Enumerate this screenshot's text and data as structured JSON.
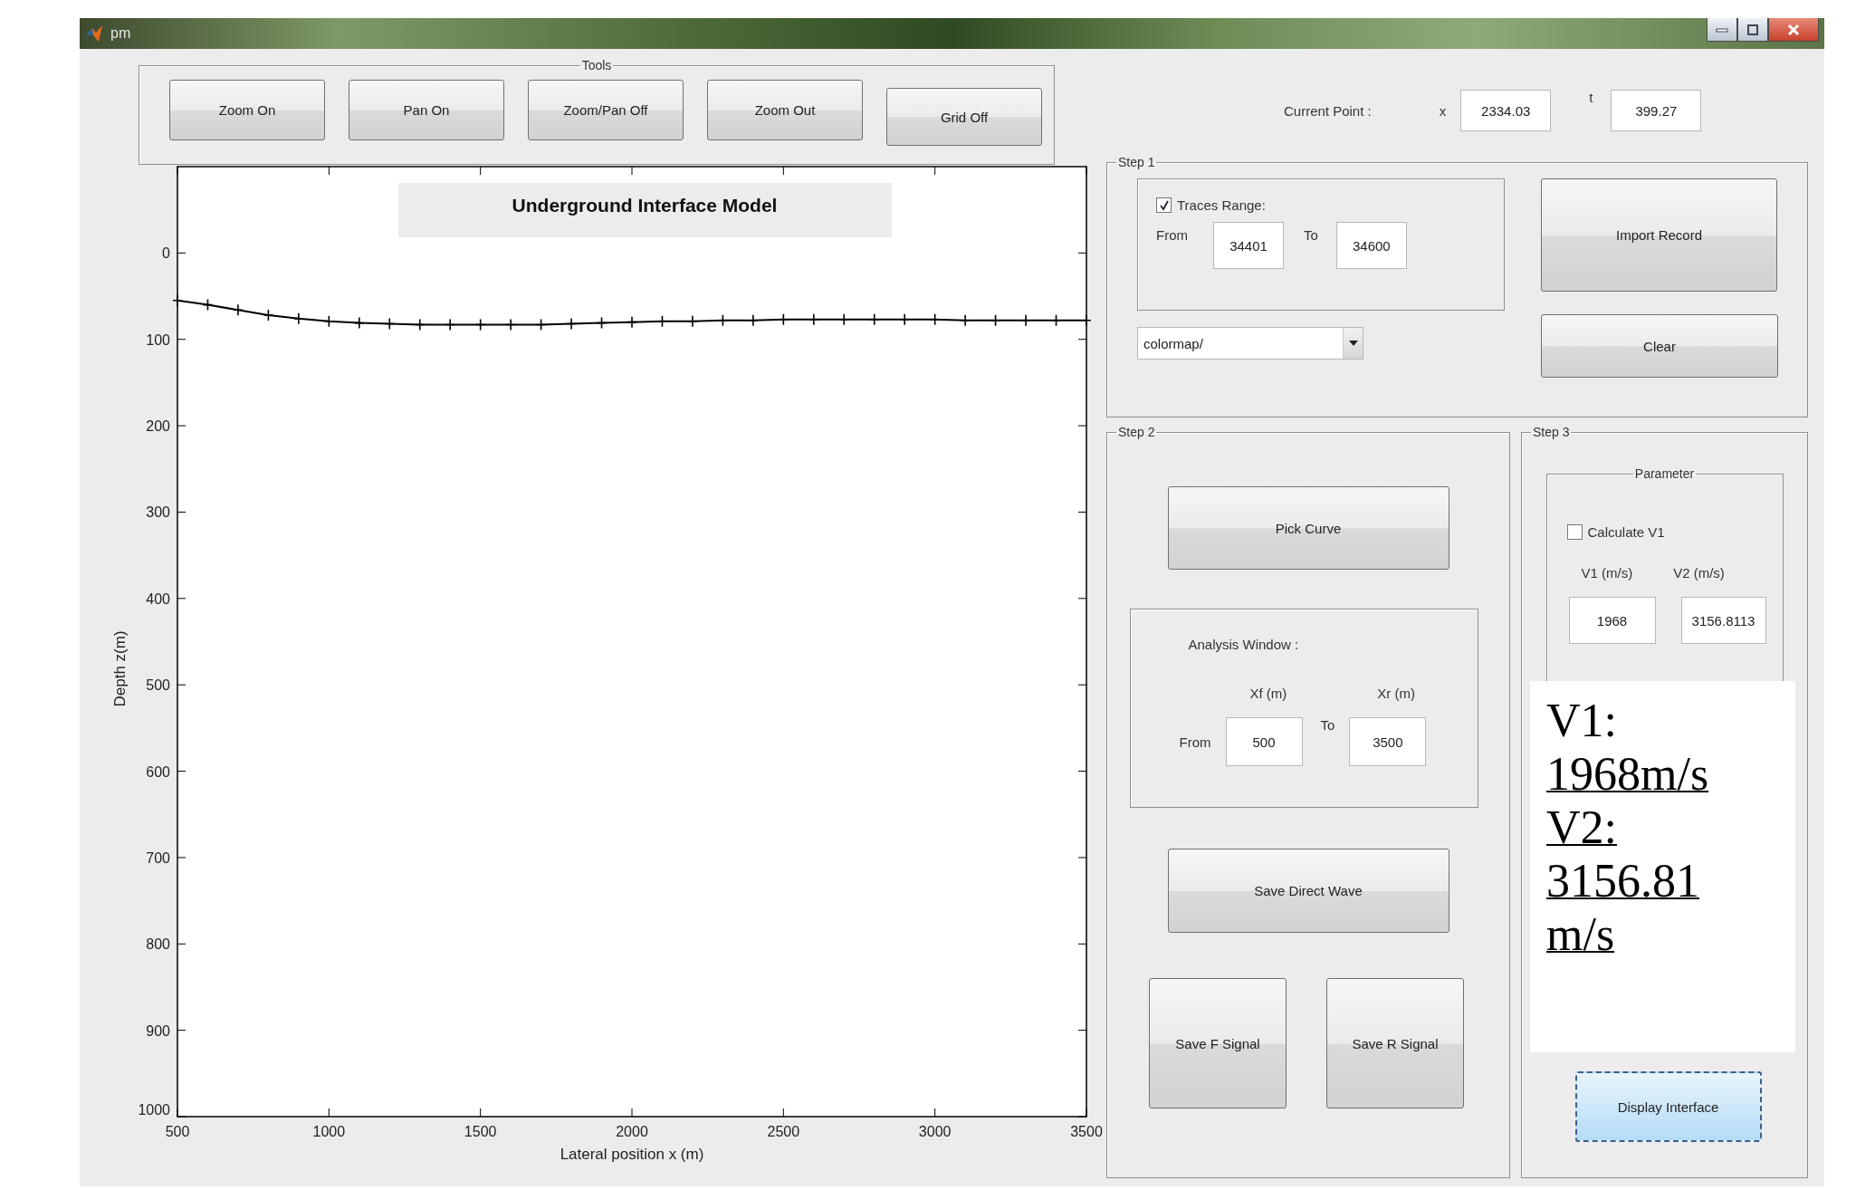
{
  "window": {
    "title": "pm"
  },
  "tools": {
    "title": "Tools",
    "buttons": [
      "Zoom On",
      "Pan On",
      "Zoom/Pan Off",
      "Zoom Out",
      "Grid Off"
    ]
  },
  "plot": {
    "chart_data": {
      "type": "line",
      "title": "Underground Interface Model",
      "xlabel": "Lateral position x (m)",
      "ylabel": "Depth z(m)",
      "x": [
        500,
        600,
        700,
        800,
        900,
        1000,
        1100,
        1200,
        1300,
        1400,
        1500,
        1600,
        1700,
        1800,
        1900,
        2000,
        2100,
        2200,
        2300,
        2400,
        2500,
        2600,
        2700,
        2800,
        2900,
        3000,
        3100,
        3200,
        3300,
        3400,
        3500
      ],
      "series": [
        {
          "color": "#000000",
          "marker": "+",
          "values": [
            55,
            60,
            66,
            72,
            76,
            79,
            81,
            82,
            83,
            83,
            83,
            83,
            83,
            82,
            81,
            80,
            79,
            79,
            78,
            78,
            77,
            77,
            77,
            77,
            77,
            77,
            78,
            78,
            78,
            78,
            78
          ]
        }
      ],
      "xlim": [
        500,
        3500
      ],
      "ylim": [
        1000,
        -100
      ],
      "xticks": [
        500,
        1000,
        1500,
        2000,
        2500,
        3000,
        3500
      ],
      "yticks": [
        0,
        100,
        200,
        300,
        400,
        500,
        600,
        700,
        800,
        900,
        1000
      ]
    }
  },
  "current_point": {
    "label": "Current Point :",
    "x_label": "x",
    "x_value": "2334.03",
    "t_label": "t",
    "t_value": "399.27"
  },
  "step1": {
    "title": "Step 1",
    "traces_range": {
      "label": "Traces Range:",
      "checked": true
    },
    "from_label": "From",
    "from_value": "34401",
    "to_label": "To",
    "to_value": "34600",
    "colormap": "colormap/",
    "buttons": [
      "Import Record",
      "Clear"
    ]
  },
  "step2": {
    "title": "Step 2",
    "pick_button": "Pick Curve",
    "analysis": {
      "title": "Analysis Window :",
      "xf_label": "Xf (m)",
      "xr_label": "Xr (m)",
      "from_label": "From",
      "from_value": "500",
      "to_label": "To",
      "to_value": "3500"
    },
    "save_direct_button": "Save Direct Wave",
    "signal_buttons": [
      "Save F Signal",
      "Save R Signal"
    ]
  },
  "step3": {
    "title": "Step 3",
    "parameter": {
      "title": "Parameter",
      "calculate_v1": {
        "label": "Calculate V1",
        "checked": false
      },
      "v1_label": "V1 (m/s)",
      "v2_label": "V2 (m/s)",
      "v1_value": "1968",
      "v2_value": "3156.8113"
    },
    "display_button": {
      "label": "Display Interface",
      "focused": true
    }
  },
  "annotation": {
    "lines": [
      {
        "text": "V1:",
        "underlined": false
      },
      {
        "text": "1968m/s",
        "underlined": true
      },
      {
        "text": "V2:",
        "underlined": true
      },
      {
        "text": "3156.81",
        "underlined": true
      },
      {
        "text": "m/s",
        "underlined": true
      }
    ]
  }
}
